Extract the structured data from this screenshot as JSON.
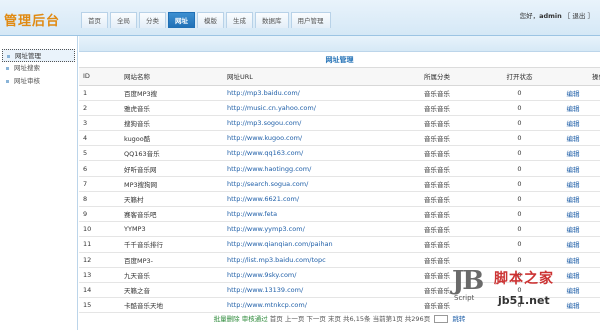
{
  "app": {
    "logo": "管理后台"
  },
  "nav": {
    "tabs": [
      {
        "label": "首页",
        "active": false
      },
      {
        "label": "全局",
        "active": false
      },
      {
        "label": "分类",
        "active": false
      },
      {
        "label": "网址",
        "active": true
      },
      {
        "label": "模版",
        "active": false
      },
      {
        "label": "生成",
        "active": false
      },
      {
        "label": "数据库",
        "active": false
      },
      {
        "label": "用户管理",
        "active": false
      }
    ]
  },
  "user": {
    "greeting": "您好，",
    "name": "admin",
    "logout": "［ 退出 ］"
  },
  "sidebar": {
    "items": [
      {
        "label": "网址管理",
        "active": true
      },
      {
        "label": "网址搜索",
        "active": false
      },
      {
        "label": "网址审核",
        "active": false
      }
    ]
  },
  "main": {
    "title": "网址管理",
    "columns": [
      "ID",
      "网站名称",
      "网址URL",
      "所属分类",
      "打开状态",
      "",
      "操作"
    ],
    "rows": [
      {
        "id": "1",
        "name": "百度MP3搜",
        "url": "http://mp3.baidu.com/",
        "cat": "音乐音乐",
        "open": "0",
        "edit": "编辑"
      },
      {
        "id": "2",
        "name": "雅虎音乐",
        "url": "http://music.cn.yahoo.com/",
        "cat": "音乐音乐",
        "open": "0",
        "edit": "编辑"
      },
      {
        "id": "3",
        "name": "搜狗音乐",
        "url": "http://mp3.sogou.com/",
        "cat": "音乐音乐",
        "open": "0",
        "edit": "编辑"
      },
      {
        "id": "4",
        "name": "kugoo酷",
        "url": "http://www.kugoo.com/",
        "cat": "音乐音乐",
        "open": "0",
        "edit": "编辑"
      },
      {
        "id": "5",
        "name": "QQ163音乐",
        "url": "http://www.qq163.com/",
        "cat": "音乐音乐",
        "open": "0",
        "edit": "编辑"
      },
      {
        "id": "6",
        "name": "好听音乐网",
        "url": "http://www.haotingg.com/",
        "cat": "音乐音乐",
        "open": "0",
        "edit": "编辑"
      },
      {
        "id": "7",
        "name": "MP3搜狗网",
        "url": "http://search.sogua.com/",
        "cat": "音乐音乐",
        "open": "0",
        "edit": "编辑"
      },
      {
        "id": "8",
        "name": "天籁村",
        "url": "http://www.6621.com/",
        "cat": "音乐音乐",
        "open": "0",
        "edit": "编辑"
      },
      {
        "id": "9",
        "name": "赛客音乐吧",
        "url": "http://www.feta",
        "cat": "音乐音乐",
        "open": "0",
        "edit": "编辑"
      },
      {
        "id": "10",
        "name": "YYMP3",
        "url": "http://www.yymp3.com/",
        "cat": "音乐音乐",
        "open": "0",
        "edit": "编辑"
      },
      {
        "id": "11",
        "name": "千千音乐排行",
        "url": "http://www.qianqian.com/paihan",
        "cat": "音乐音乐",
        "open": "0",
        "edit": "编辑"
      },
      {
        "id": "12",
        "name": "百度MP3-",
        "url": "http://list.mp3.baidu.com/topc",
        "cat": "音乐音乐",
        "open": "0",
        "edit": "编辑"
      },
      {
        "id": "13",
        "name": "九天音乐",
        "url": "http://www.9sky.com/",
        "cat": "音乐音乐",
        "open": "0",
        "edit": "编辑"
      },
      {
        "id": "14",
        "name": "天籁之音",
        "url": "http://www.13139.com/",
        "cat": "音乐音乐",
        "open": "0",
        "edit": "编辑"
      },
      {
        "id": "15",
        "name": "卡酷音乐天地",
        "url": "http://www.mtnkcp.com/",
        "cat": "音乐音乐",
        "open": "0",
        "edit": "编辑"
      }
    ],
    "pager": {
      "selected": "批量删除  审核通过",
      "nav": "首页 上一页 下一页 末页 共6,15条 当前第1页 共296页",
      "go": "跳转"
    }
  },
  "watermark": {
    "jb": "JB",
    "script": "Script",
    "cn": "脚本之家",
    "url": "jb51.net"
  }
}
